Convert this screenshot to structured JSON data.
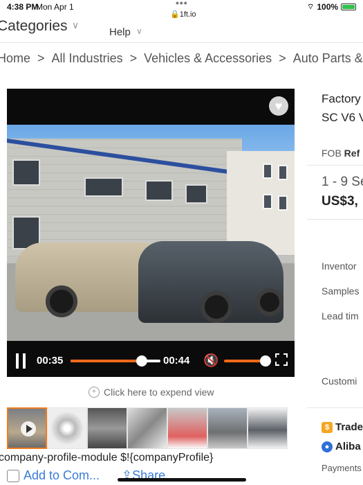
{
  "status_bar": {
    "time": "4:38 PM",
    "date": "Mon Apr 1",
    "url": "1ft.io",
    "battery": "100%"
  },
  "nav": {
    "categories": "Categories",
    "help": "Help"
  },
  "breadcrumb": [
    "Home",
    "All Industries",
    "Vehicles & Accessories",
    "Auto Parts &"
  ],
  "video": {
    "current_time": "00:35",
    "duration": "00:44",
    "progress": 0.795,
    "volume": 0.85
  },
  "expand_text": "Click here to expend view",
  "thumbnails": [
    {
      "name": "video"
    },
    {
      "name": "parts-1"
    },
    {
      "name": "parts-2"
    },
    {
      "name": "parts-3"
    },
    {
      "name": "parts-4"
    },
    {
      "name": "showroom"
    },
    {
      "name": "car-side"
    }
  ],
  "module_text": "company-profile-module $!{companyProfile}",
  "actions": {
    "compare": "Add to Com...",
    "share": "Share"
  },
  "product": {
    "title_line1": "Factory",
    "title_line2": "SC V6 V",
    "fob_label": "FOB",
    "fob_ref": "Ref",
    "qty": "1 - 9 Se",
    "price": "US$3,",
    "labels": [
      "Inventor",
      "Samples",
      "Lead tim",
      "Customi"
    ],
    "badge_trade": "Trade",
    "badge_alibaba": "Aliba",
    "payments": "Payments"
  },
  "colors": {
    "accent": "#f06a1a",
    "link": "#3a7bd5"
  }
}
